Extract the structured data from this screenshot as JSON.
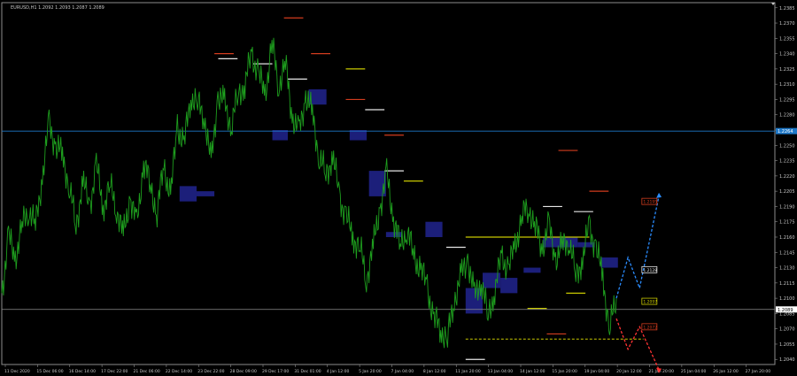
{
  "window": {
    "symbol_info": "EURUSD,H1 1.2092 1.2093 1.2087 1.2089"
  },
  "colors": {
    "background": "#000000",
    "frame": "#8c8c8c",
    "price": "#1e9e1e",
    "zone": "#1c1f7a",
    "white_level": "#e6e6e6",
    "yellow_level": "#c8c800",
    "red_level": "#d23c1e",
    "blue_line": "#1e78c8",
    "grey_line": "#8c8c8c",
    "projection_blue": "#2a8cff",
    "projection_red": "#ff3333"
  },
  "chart_data": {
    "type": "line",
    "title": "",
    "xlabel": "",
    "ylabel": "",
    "y_ticks": [
      "1.2385",
      "1.2370",
      "1.2355",
      "1.2340",
      "1.2325",
      "1.2310",
      "1.2295",
      "1.2280",
      "1.2265",
      "1.2250",
      "1.2235",
      "1.2220",
      "1.2205",
      "1.2190",
      "1.2175",
      "1.2160",
      "1.2145",
      "1.2130",
      "1.2115",
      "1.2100",
      "1.2085",
      "1.2070",
      "1.2055",
      "1.2040"
    ],
    "x_ticks": [
      "11 Dec 2020",
      "15 Dec 06:00",
      "16 Dec 14:00",
      "17 Dec 22:00",
      "21 Dec 06:00",
      "22 Dec 14:00",
      "23 Dec 22:00",
      "28 Dec 09:00",
      "29 Dec 17:00",
      "31 Dec 01:00",
      "4 Jan 12:00",
      "5 Jan 20:00",
      "7 Jan 04:00",
      "8 Jan 12:00",
      "11 Jan 20:00",
      "13 Jan 04:00",
      "14 Jan 12:00",
      "15 Jan 20:00",
      "19 Jan 04:00",
      "20 Jan 12:00",
      "21 Jan 20:00",
      "25 Jan 04:00",
      "26 Jan 12:00",
      "27 Jan 20:00"
    ],
    "current_price_label": "1.2089",
    "hline_blue_label": "1.2264",
    "projection_labels": [
      "1.2195",
      "1.2128",
      "1.2097",
      "1.2072"
    ],
    "series": [
      {
        "values": [
          1.2105,
          1.216,
          1.214,
          1.217,
          1.219,
          1.217,
          1.222,
          1.227,
          1.225,
          1.224,
          1.221,
          1.217,
          1.2215,
          1.219,
          1.223,
          1.219,
          1.221,
          1.219,
          1.216,
          1.22,
          1.217,
          1.2235,
          1.221,
          1.2185,
          1.223,
          1.22,
          1.227,
          1.225,
          1.23,
          1.229,
          1.228,
          1.223,
          1.23,
          1.229,
          1.227,
          1.23,
          1.231,
          1.234,
          1.232,
          1.23,
          1.235,
          1.231,
          1.233,
          1.228,
          1.226,
          1.23,
          1.228,
          1.224,
          1.222,
          1.224,
          1.22,
          1.218,
          1.216,
          1.215,
          1.212,
          1.215,
          1.219,
          1.222,
          1.218,
          1.215,
          1.217,
          1.214,
          1.213,
          1.211,
          1.208,
          1.207,
          1.206,
          1.21,
          1.212,
          1.214,
          1.21,
          1.212,
          1.208,
          1.211,
          1.214,
          1.213,
          1.215,
          1.218,
          1.219,
          1.217,
          1.215,
          1.217,
          1.214,
          1.215,
          1.216,
          1.212,
          1.214,
          1.217,
          1.215,
          1.212,
          1.207,
          1.21
        ]
      }
    ],
    "projections": {
      "blue": [
        1.21,
        1.214,
        1.211,
        1.22
      ],
      "red": [
        1.208,
        1.205,
        1.2072,
        1.203
      ]
    },
    "zones": [
      {
        "x": [
          0.23,
          0.252
        ],
        "y": [
          1.2195,
          1.221
        ]
      },
      {
        "x": [
          0.252,
          0.275
        ],
        "y": [
          1.22,
          1.2205
        ]
      },
      {
        "x": [
          0.35,
          0.37
        ],
        "y": [
          1.2255,
          1.2265
        ]
      },
      {
        "x": [
          0.397,
          0.42
        ],
        "y": [
          1.229,
          1.2305
        ]
      },
      {
        "x": [
          0.45,
          0.472
        ],
        "y": [
          1.2255,
          1.2265
        ]
      },
      {
        "x": [
          0.475,
          0.497
        ],
        "y": [
          1.22,
          1.2225
        ]
      },
      {
        "x": [
          0.497,
          0.518
        ],
        "y": [
          1.216,
          1.2165
        ]
      },
      {
        "x": [
          0.548,
          0.57
        ],
        "y": [
          1.216,
          1.2175
        ]
      },
      {
        "x": [
          0.6,
          0.622
        ],
        "y": [
          1.2085,
          1.211
        ]
      },
      {
        "x": [
          0.622,
          0.645
        ],
        "y": [
          1.211,
          1.2125
        ]
      },
      {
        "x": [
          0.645,
          0.667
        ],
        "y": [
          1.2105,
          1.212
        ]
      },
      {
        "x": [
          0.675,
          0.697
        ],
        "y": [
          1.2125,
          1.213
        ]
      },
      {
        "x": [
          0.7,
          0.722
        ],
        "y": [
          1.215,
          1.216
        ]
      },
      {
        "x": [
          0.722,
          0.745
        ],
        "y": [
          1.215,
          1.216
        ]
      },
      {
        "x": [
          0.745,
          0.767
        ],
        "y": [
          1.215,
          1.2155
        ]
      },
      {
        "x": [
          0.775,
          0.797
        ],
        "y": [
          1.213,
          1.214
        ]
      }
    ],
    "levels": [
      {
        "c": "white_level",
        "x": [
          0.28,
          0.305
        ],
        "y": 1.2335
      },
      {
        "c": "red_level",
        "x": [
          0.275,
          0.3
        ],
        "y": 1.234
      },
      {
        "c": "white_level",
        "x": [
          0.325,
          0.35
        ],
        "y": 1.233
      },
      {
        "c": "red_level",
        "x": [
          0.365,
          0.39
        ],
        "y": 1.2375
      },
      {
        "c": "white_level",
        "x": [
          0.37,
          0.395
        ],
        "y": 1.2315
      },
      {
        "c": "red_level",
        "x": [
          0.4,
          0.425
        ],
        "y": 1.234
      },
      {
        "c": "yellow_level",
        "x": [
          0.445,
          0.47
        ],
        "y": 1.2325
      },
      {
        "c": "red_level",
        "x": [
          0.445,
          0.47
        ],
        "y": 1.2295
      },
      {
        "c": "white_level",
        "x": [
          0.47,
          0.495
        ],
        "y": 1.2285
      },
      {
        "c": "red_level",
        "x": [
          0.495,
          0.52
        ],
        "y": 1.226
      },
      {
        "c": "white_level",
        "x": [
          0.495,
          0.52
        ],
        "y": 1.2225
      },
      {
        "c": "yellow_level",
        "x": [
          0.52,
          0.545
        ],
        "y": 1.2215
      },
      {
        "c": "white_level",
        "x": [
          0.575,
          0.6
        ],
        "y": 1.215
      },
      {
        "c": "yellow_level",
        "x": [
          0.6,
          0.76
        ],
        "y": 1.216
      },
      {
        "c": "white_level",
        "x": [
          0.6,
          0.625
        ],
        "y": 1.204
      },
      {
        "c": "yellow_level",
        "x": [
          0.68,
          0.705
        ],
        "y": 1.209
      },
      {
        "c": "red_level",
        "x": [
          0.705,
          0.73
        ],
        "y": 1.2065
      },
      {
        "c": "red_level",
        "x": [
          0.72,
          0.745
        ],
        "y": 1.2245
      },
      {
        "c": "white_level",
        "x": [
          0.7,
          0.725
        ],
        "y": 1.219
      },
      {
        "c": "yellow_level",
        "x": [
          0.73,
          0.755
        ],
        "y": 1.2105
      },
      {
        "c": "red_level",
        "x": [
          0.76,
          0.785
        ],
        "y": 1.2205
      },
      {
        "c": "white_level",
        "x": [
          0.74,
          0.765
        ],
        "y": 1.2185
      }
    ]
  }
}
